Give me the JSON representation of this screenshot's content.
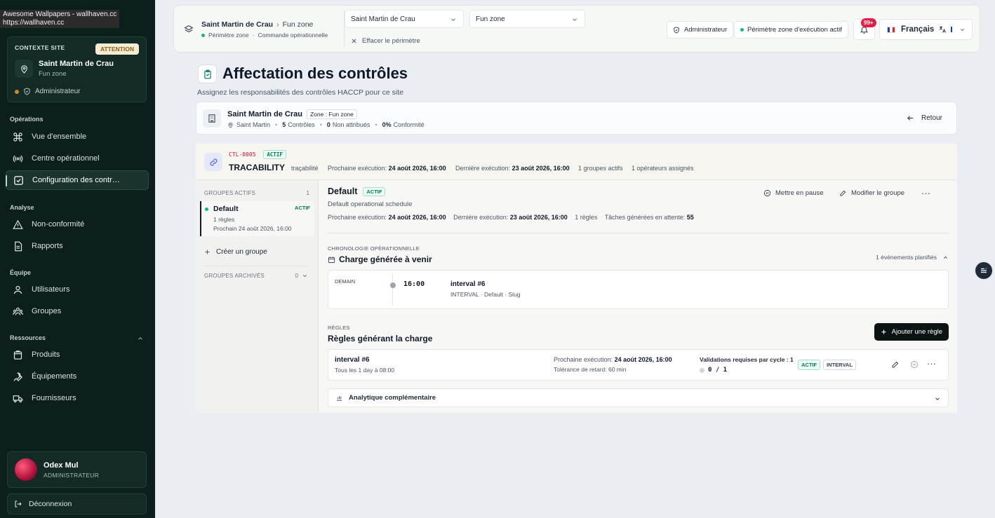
{
  "browser_tooltip": {
    "line1": "Awesome Wallpapers - wallhaven.cc",
    "line2": "https://wallhaven.cc"
  },
  "sidebar": {
    "context_label": "CONTEXTE SITE",
    "attention": "ATTENTION",
    "site_name": "Saint Martin de Crau",
    "site_zone": "Fun zone",
    "role": "Administrateur",
    "sections": {
      "operations": "Opérations",
      "analyse": "Analyse",
      "equipe": "Équipe",
      "ressources": "Ressources"
    },
    "items": {
      "overview": "Vue d'ensemble",
      "ops_center": "Centre opérationnel",
      "config": "Configuration des contr…",
      "nonconf": "Non-conformité",
      "reports": "Rapports",
      "users": "Utilisateurs",
      "groups": "Groupes",
      "products": "Produits",
      "equipment": "Équipements",
      "suppliers": "Fournisseurs"
    },
    "user_name": "Odex Mul",
    "user_role": "ADMINISTRATEUR",
    "logout": "Déconnexion"
  },
  "topbar": {
    "crumb_site": "Saint Martin de Crau",
    "crumb_zone": "Fun zone",
    "scope_status": "Périmètre zone",
    "scope_sep": "·",
    "scope_cmd": "Commande opérationnelle",
    "site_select": "Saint Martin de Crau",
    "zone_select": "Fun zone",
    "clear": "Effacer le périmètre",
    "role_pill": "Administrateur",
    "scope_pill": "Périmètre zone d'exécution actif",
    "notif_count": "99+",
    "language": "Français"
  },
  "page": {
    "title": "Affectation des contrôles",
    "subtitle": "Assignez les responsabilités des contrôles HACCP pour ce site"
  },
  "site_bar": {
    "name": "Saint Martin de Crau",
    "zone_tag": "Zone : Fun zone",
    "location": "Saint Martin",
    "controls_num": "5",
    "controls_label": "Contrôles",
    "unassigned_num": "0",
    "unassigned_label": "Non attribués",
    "compliance_num": "0%",
    "compliance_label": "Conformité",
    "back": "Retour"
  },
  "control": {
    "code": "CTL-0005",
    "status": "ACTIF",
    "name": "TRACABILITY",
    "category": "traçabilité",
    "next_label": "Prochaine exécution:",
    "next_value": "24 août 2026, 16:00",
    "last_label": "Dernière exécution:",
    "last_value": "23 août 2026, 16:00",
    "active_groups": "1 groupes actifs",
    "operators": "1 opérateurs assignés"
  },
  "groups_panel": {
    "active_label": "GROUPES ACTIFS",
    "active_count": "1",
    "group_name": "Default",
    "group_status": "ACTIF",
    "group_rules": "1 règles",
    "group_next": "Prochain 24 août 2026, 16:00",
    "create": "Créer un groupe",
    "archived_label": "GROUPES ARCHIVÉS",
    "archived_count": "0"
  },
  "group_detail": {
    "name": "Default",
    "status": "ACTIF",
    "description": "Default operational schedule",
    "next_label": "Prochaine exécution:",
    "next_value": "24 août 2026, 16:00",
    "last_label": "Dernière exécution:",
    "last_value": "23 août 2026, 16:00",
    "rules": "1 règles",
    "pending_label": "Tâches générées en attente:",
    "pending_value": "55",
    "pause": "Mettre en pause",
    "edit": "Modifier le groupe"
  },
  "timeline": {
    "section_label": "CHRONOLOGIE OPÉRATIONNELLE",
    "title": "Charge générée à venir",
    "events": "1 événements planifiés",
    "day": "DEMAIN",
    "time": "16:00",
    "name": "interval #6",
    "sub": "INTERVAL · Default · Slug"
  },
  "rules": {
    "section_label": "RÈGLES",
    "title": "Règles générant la charge",
    "add": "Ajouter une règle",
    "rule_name": "interval #6",
    "rule_sub": "Tous les 1 day à 08:00",
    "next_label": "Prochaine exécution:",
    "next_value": "24 août 2026, 16:00",
    "tolerance": "Tolérance de retard: 60 min",
    "validations": "Validations requises par cycle : 1",
    "progress": "0 / 1",
    "tag_actif": "ACTIF",
    "tag_interval": "INTERVAL"
  },
  "analytics": {
    "label": "Analytique complémentaire"
  },
  "colors": {
    "sidebar_bg": "#0d1f1c",
    "accent_green": "#10b981",
    "danger": "#e11d48",
    "code_red": "#be123c"
  }
}
